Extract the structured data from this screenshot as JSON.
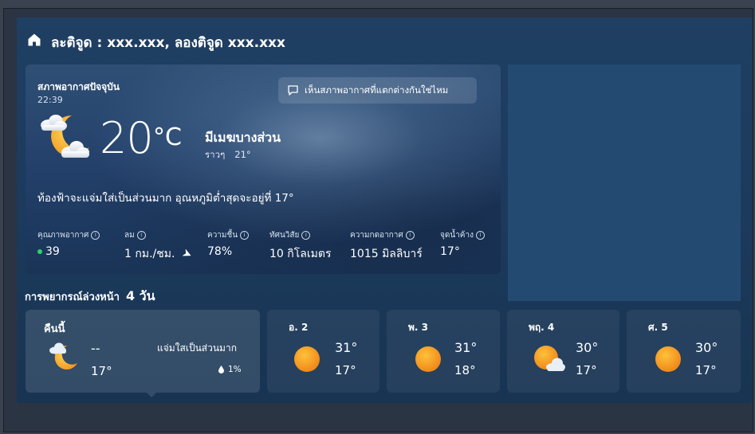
{
  "header": {
    "location": "ละติจูด : xxx.xxx, ลองติจูด xxx.xxx"
  },
  "current": {
    "label": "สภาพอากาศปัจจุบัน",
    "time": "22:39",
    "feedback_label": "เห็นสภาพอากาศที่แตกต่างกันใช่ไหม",
    "icon": "partly-cloudy-night-icon",
    "temperature": "20",
    "unit": "°C",
    "condition": "มีเมฆบางส่วน",
    "feels_like_label": "ราวๆ",
    "feels_like_value": "21°",
    "summary": "ท้องฟ้าจะแจ่มใส่เป็นส่วนมาก อุณหภูมิต่ำสุดจะอยู่ที่ 17°",
    "details": [
      {
        "label": "คุณภาพอากาศ",
        "value": "39"
      },
      {
        "label": "ลม",
        "value": "1 กม./ชม."
      },
      {
        "label": "ความชื้น",
        "value": "78%"
      },
      {
        "label": "ทัศนวิสัย",
        "value": "10 กิโลเมตร"
      },
      {
        "label": "ความกดอากาศ",
        "value": "1015 มิลลิบาร์"
      },
      {
        "label": "จุดน้ำค้าง",
        "value": "17°"
      }
    ]
  },
  "forecast": {
    "title": "การพยากรณ์ล่วงหน้า",
    "days_label": "4 วัน",
    "today": {
      "name": "คืนนี้",
      "icon": "partly-cloudy-night-icon",
      "high": "--",
      "low": "17°",
      "condition": "แจ่มใสเป็นส่วนมาก",
      "precip": "1%"
    },
    "days": [
      {
        "name": "อ. 2",
        "icon": "sun-icon",
        "high": "31°",
        "low": "17°"
      },
      {
        "name": "พ. 3",
        "icon": "sun-icon",
        "high": "31°",
        "low": "18°"
      },
      {
        "name": "พฤ. 4",
        "icon": "partly-sunny-icon",
        "high": "30°",
        "low": "17°"
      },
      {
        "name": "ศ. 5",
        "icon": "sun-icon",
        "high": "30°",
        "low": "17°"
      }
    ]
  },
  "colors": {
    "background": "#1f3f63",
    "aqi_good": "#2bd36b",
    "sun": "#f39a1f"
  }
}
